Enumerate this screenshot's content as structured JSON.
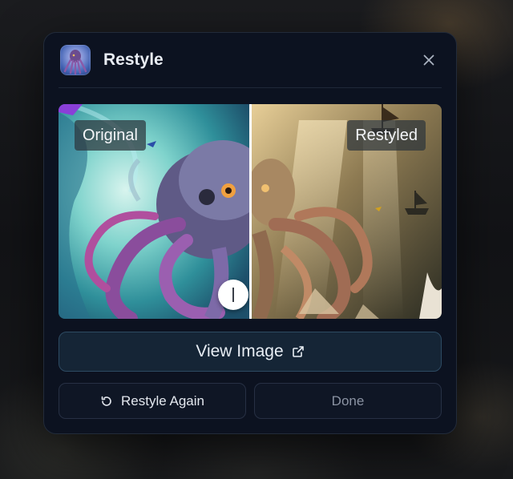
{
  "dialog": {
    "title": "Restyle",
    "app_icon": "octopus-thumbnail",
    "close_icon": "close-icon"
  },
  "comparison": {
    "left_label": "Original",
    "right_label": "Restyled",
    "handle_icon": "split-handle-icon"
  },
  "actions": {
    "view_image_label": "View Image",
    "view_image_icon": "external-link-icon",
    "restyle_again_label": "Restyle Again",
    "restyle_again_icon": "rotate-ccw-icon",
    "done_label": "Done"
  },
  "colors": {
    "modal_bg": "#0c1220",
    "primary_button_bg": "#152536",
    "primary_button_border": "#2d4a62",
    "text": "#e8ecf3",
    "muted_text": "#8b93a3"
  }
}
